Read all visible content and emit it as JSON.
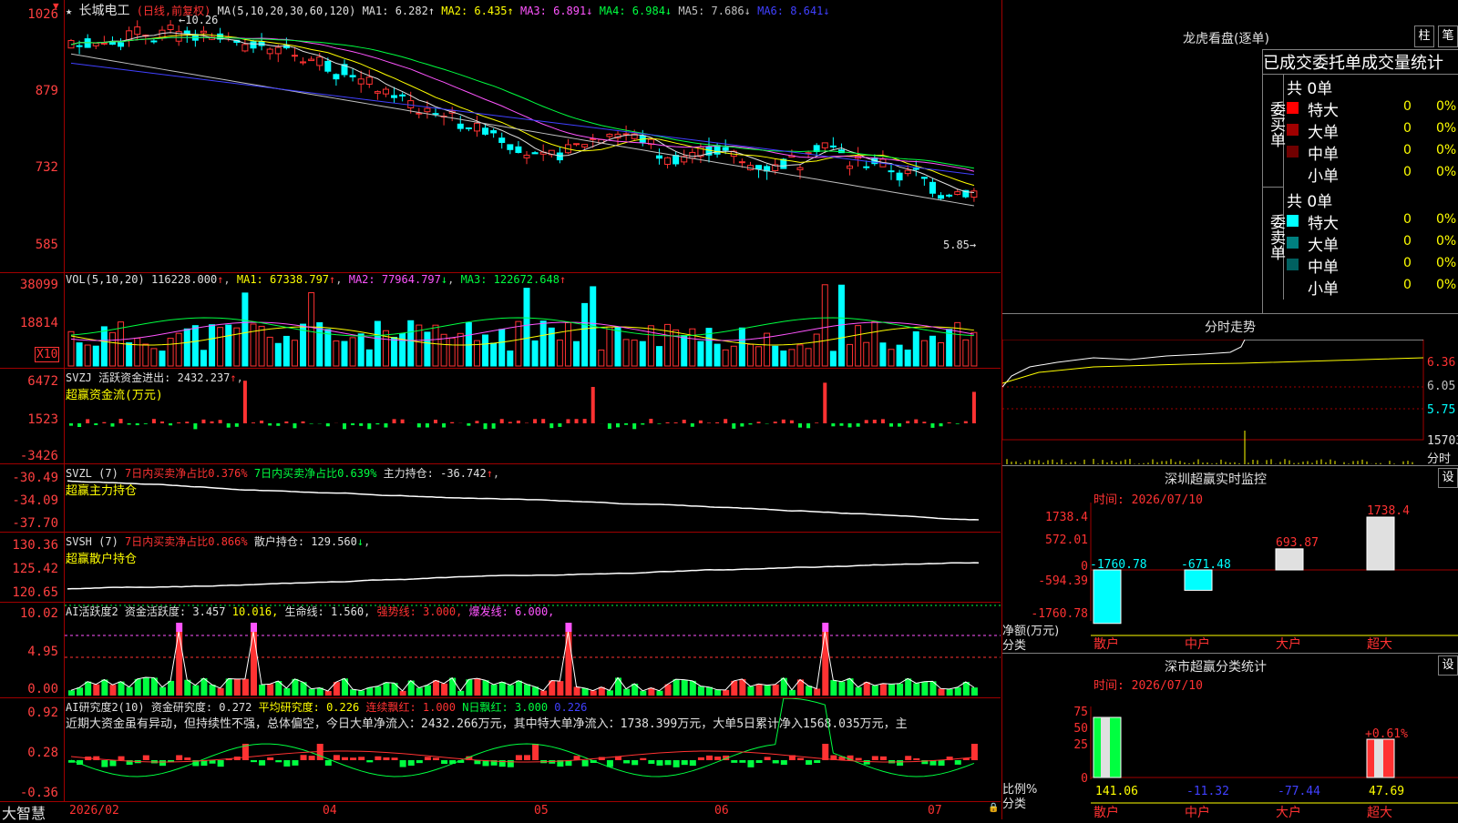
{
  "app": {
    "brand": "大智慧"
  },
  "kline": {
    "stock_name": "长城电工",
    "period": "(日线,前复权)",
    "ma_title": "MA(5,10,20,30,60,120)",
    "ma_items": [
      {
        "label": "MA1: 6.282",
        "arrow": "↑",
        "color": "#e0e0e0"
      },
      {
        "label": "MA2: 6.435",
        "arrow": "↑",
        "color": "#ffff00"
      },
      {
        "label": "MA3: 6.891",
        "arrow": "↓",
        "color": "#ff55ff"
      },
      {
        "label": "MA4: 6.984",
        "arrow": "↓",
        "color": "#00ff40"
      },
      {
        "label": "MA5: 7.686",
        "arrow": "↓",
        "color": "#c0c0c0"
      },
      {
        "label": "MA6: 8.641",
        "arrow": "↓",
        "color": "#4040ff"
      }
    ],
    "y_labels": [
      "1026",
      "879",
      "732",
      "585"
    ],
    "high_label": "10.26",
    "low_label": "5.85"
  },
  "vol": {
    "title": "VOL(5,10,20)",
    "value": "116228.000",
    "ma1": "MA1: 67338.797",
    "ma2": "MA2: 77964.797",
    "ma3": "MA3: 122672.648",
    "y_labels": [
      "38099",
      "18814"
    ],
    "unit": "X10"
  },
  "svzj": {
    "title": "SVZJ",
    "item": "活跃资金进出: 2432.237",
    "subtitle": "超赢资金流(万元)",
    "y_labels": [
      "6472",
      "1523",
      "-3426"
    ]
  },
  "svzl": {
    "title": "SVZL (7)",
    "red_text": "7日内买卖净占比0.376%",
    "grn_text": "7日内买卖净占比0.639%",
    "item": "主力持仓: -36.742",
    "subtitle": "超赢主力持仓",
    "y_labels": [
      "-30.49",
      "-34.09",
      "-37.70"
    ]
  },
  "svsh": {
    "title": "SVSH (7)",
    "red_text": "7日内买卖净占比0.866%",
    "item": "散户持仓: 129.560",
    "subtitle": "超赢散户持仓",
    "y_labels": [
      "130.36",
      "125.42",
      "120.65"
    ]
  },
  "ai1": {
    "title": "AI活跃度2",
    "items": [
      {
        "label": "资金活跃度: 3.457",
        "color": "#e0e0e0"
      },
      {
        "label": "10.016,",
        "color": "#ffff00"
      },
      {
        "label": "生命线: 1.560,",
        "color": "#e0e0e0"
      },
      {
        "label": "强势线: 3.000,",
        "color": "#ff3232"
      },
      {
        "label": "爆发线: 6.000,",
        "color": "#ff55ff"
      }
    ],
    "y_labels": [
      "10.02",
      "4.95",
      "0.00"
    ]
  },
  "ai2": {
    "title": "AI研究度2(10)",
    "items": [
      {
        "label": "资金研究度: 0.272",
        "color": "#e0e0e0"
      },
      {
        "label": "平均研究度: 0.226",
        "color": "#ffff00"
      },
      {
        "label": "连续飘红: 1.000",
        "color": "#ff3232"
      },
      {
        "label": "N日飘红: 3.000",
        "color": "#00ff40"
      },
      {
        "label": "0.226",
        "color": "#4040ff"
      }
    ],
    "comment": "近期大资金虽有异动，但持续性不强，总体偏空，今日大单净流入：2432.266万元，其中特大单净流入：1738.399万元，大单5日累计净入1568.035万元，主",
    "y_labels": [
      "0.92",
      "0.28",
      "-0.36"
    ]
  },
  "xaxis": {
    "labels": [
      "2026/02",
      "04",
      "05",
      "06",
      "07"
    ]
  },
  "right": {
    "lhkp_title": "龙虎看盘(逐单)",
    "btn_zhu": "柱",
    "btn_bi": "笔",
    "stats_title": "已成交委托单成交量统计",
    "buy": {
      "vlabel": "委买单",
      "total": "共 0单",
      "rows": [
        {
          "name": "特大",
          "count": "0",
          "pct": "0%",
          "color": "#ff0000"
        },
        {
          "name": "大单",
          "count": "0",
          "pct": "0%",
          "color": "#a00000"
        },
        {
          "name": "中单",
          "count": "0",
          "pct": "0%",
          "color": "#700000"
        },
        {
          "name": "小单",
          "count": "0",
          "pct": "0%",
          "color": ""
        }
      ]
    },
    "sell": {
      "vlabel": "委卖单",
      "total": "共 0单",
      "rows": [
        {
          "name": "特大",
          "count": "0",
          "pct": "0%",
          "color": "#00ffff"
        },
        {
          "name": "大单",
          "count": "0",
          "pct": "0%",
          "color": "#008080"
        },
        {
          "name": "中单",
          "count": "0",
          "pct": "0%",
          "color": "#006060"
        },
        {
          "name": "小单",
          "count": "0",
          "pct": "0%",
          "color": ""
        }
      ]
    },
    "fenshi": {
      "title": "分时走势",
      "y_labels": [
        "6.36",
        "6.05",
        "5.75"
      ],
      "vol_label": "15703",
      "vol_unit": "分时"
    },
    "monitor": {
      "title": "深圳超赢实时监控",
      "btn": "设",
      "time": "时间: 2026/07/10",
      "y_labels": [
        "1738.4",
        "572.01",
        "0",
        "-594.39",
        "-1760.78"
      ],
      "ylabel": "净额(万元)",
      "xlabel": "分类",
      "bars": [
        {
          "name": "散户",
          "value": -1760.78,
          "label": "-1760.78"
        },
        {
          "name": "中户",
          "value": -671.48,
          "label": "-671.48"
        },
        {
          "name": "大户",
          "value": 693.87,
          "label": "693.87"
        },
        {
          "name": "超大",
          "value": 1738.4,
          "label": "1738.4"
        }
      ]
    },
    "classify": {
      "title": "深市超赢分类统计",
      "btn": "设",
      "time": "时间: 2026/07/10",
      "y_labels": [
        "75",
        "50",
        "25",
        "0"
      ],
      "ylabel": "比例%",
      "xlabel": "分类",
      "bars": [
        {
          "name": "散户",
          "value": 141.06,
          "label": "141.06"
        },
        {
          "name": "中户",
          "value": -11.32,
          "label": "-11.32"
        },
        {
          "name": "大户",
          "value": -77.44,
          "label": "-77.44"
        },
        {
          "name": "超大",
          "value": 47.69,
          "label": "47.69",
          "top": "+0.61%"
        }
      ]
    }
  },
  "chart_data": [
    {
      "type": "bar",
      "title": "深圳超赢实时监控",
      "ylabel": "净额(万元)",
      "categories": [
        "散户",
        "中户",
        "大户",
        "超大"
      ],
      "values": [
        -1760.78,
        -671.48,
        693.87,
        1738.4
      ],
      "ylim": [
        -1760.78,
        1738.4
      ]
    },
    {
      "type": "bar",
      "title": "深市超赢分类统计",
      "ylabel": "比例%",
      "categories": [
        "散户",
        "中户",
        "大户",
        "超大"
      ],
      "values": [
        141.06,
        -11.32,
        -77.44,
        47.69
      ],
      "ylim": [
        0,
        75
      ]
    }
  ]
}
